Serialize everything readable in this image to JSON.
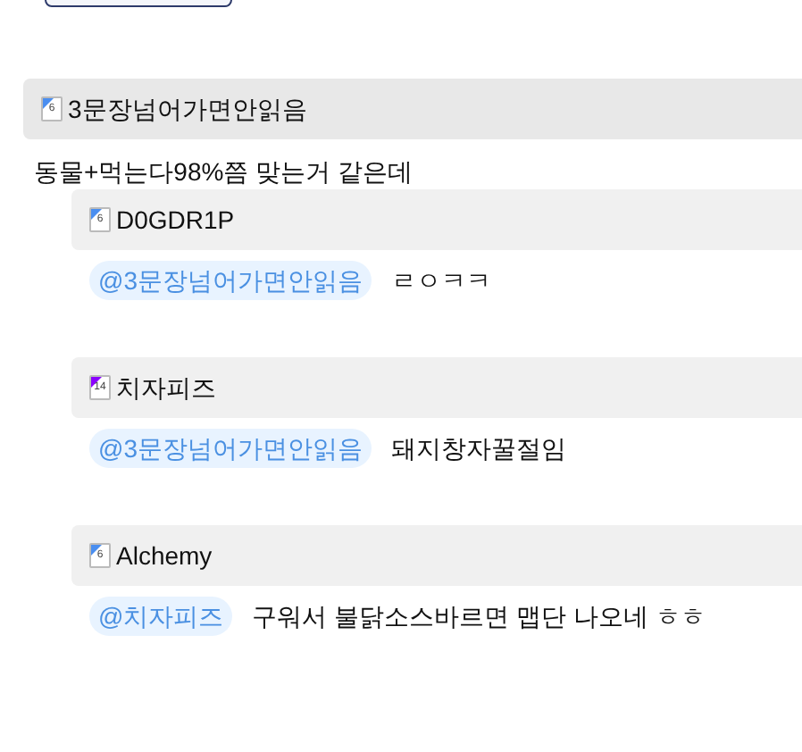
{
  "comment": {
    "author": {
      "name": "3문장넘어가면안읽음",
      "level": "6",
      "color": "#4a8ef0"
    },
    "text": "동물+먹는다98%쯤 맞는거 같은데"
  },
  "replies": [
    {
      "author": {
        "name": "D0GDR1P",
        "level": "6",
        "color": "#4a8ef0"
      },
      "mention": "@3문장넘어가면안읽음",
      "text": "ㄹㅇㅋㅋ"
    },
    {
      "author": {
        "name": "치자피즈",
        "level": "14",
        "color": "#8a00ff"
      },
      "mention": "@3문장넘어가면안읽음",
      "text": "돼지창자꿀절임"
    },
    {
      "author": {
        "name": "Alchemy",
        "level": "6",
        "color": "#4a8ef0"
      },
      "mention": "@치자피즈",
      "text": "구워서 불닭소스바르면 맵단 나오네 ㅎㅎ"
    }
  ]
}
